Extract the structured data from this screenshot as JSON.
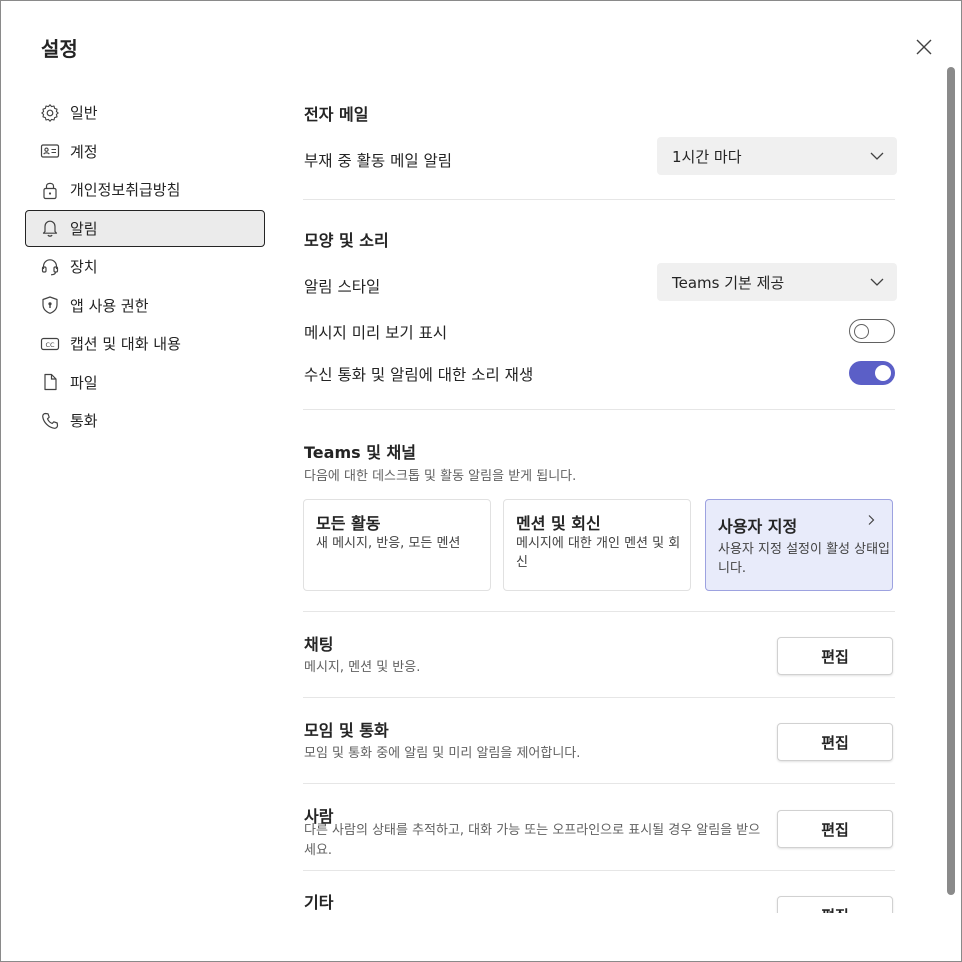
{
  "dialog": {
    "title": "설정",
    "close_icon": "close-icon"
  },
  "sidebar": {
    "items": [
      {
        "label": "일반",
        "icon": "gear-icon",
        "active": false
      },
      {
        "label": "계정",
        "icon": "id-card-icon",
        "active": false
      },
      {
        "label": "개인정보취급방침",
        "icon": "lock-icon",
        "active": false
      },
      {
        "label": "알림",
        "icon": "bell-icon",
        "active": true
      },
      {
        "label": "장치",
        "icon": "headset-icon",
        "active": false
      },
      {
        "label": "앱 사용 권한",
        "icon": "shield-icon",
        "active": false
      },
      {
        "label": "캡션 및 대화 내용",
        "icon": "cc-icon",
        "active": false
      },
      {
        "label": "파일",
        "icon": "file-icon",
        "active": false
      },
      {
        "label": "통화",
        "icon": "phone-icon",
        "active": false
      }
    ]
  },
  "email": {
    "heading": "전자 메일",
    "missed_activity_label": "부재 중 활동 메일 알림",
    "missed_activity_value": "1시간 마다"
  },
  "appearance": {
    "heading": "모양 및 소리",
    "style_label": "알림 스타일",
    "style_value": "Teams 기본 제공",
    "preview_label": "메시지 미리 보기 표시",
    "preview_on": false,
    "sound_label": "수신 통화 및 알림에 대한 소리 재생",
    "sound_on": true
  },
  "teams_channels": {
    "heading": "Teams 및 채널",
    "description": "다음에 대한 데스크톱 및 활동 알림을 받게 됩니다.",
    "cards": [
      {
        "title": "모든 활동",
        "desc": "새 메시지, 반응, 모든 멘션",
        "selected": false
      },
      {
        "title": "멘션 및 회신",
        "desc": "메시지에 대한 개인 멘션 및 회신",
        "selected": false
      },
      {
        "title": "사용자 지정",
        "desc": "사용자 지정 설정이 활성 상태입니다.",
        "selected": true
      }
    ]
  },
  "categories": [
    {
      "heading": "채팅",
      "desc": "메시지, 멘션 및 반응.",
      "button": "편집"
    },
    {
      "heading": "모임 및 통화",
      "desc": "모임 및 통화 중에 알림 및 미리 알림을 제어합니다.",
      "button": "편집"
    },
    {
      "heading": "사람",
      "desc": "다른 사람의 상태를 추적하고, 대화 가능 또는 오프라인으로 표시될 경우 알림을 받으세요.",
      "button": "편집"
    },
    {
      "heading": "기타",
      "desc": "",
      "button": "편집"
    }
  ],
  "colors": {
    "accent": "#5b5fc7",
    "selected_card_bg": "#e8ebfa",
    "active_nav_bg": "#ebebeb"
  }
}
